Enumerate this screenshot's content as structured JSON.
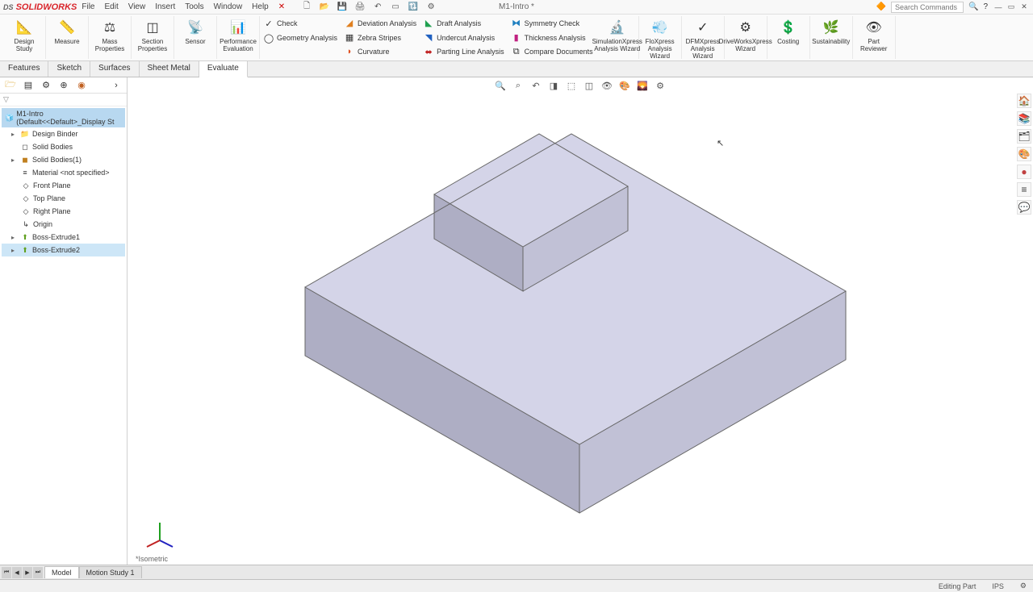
{
  "app": {
    "logo_ds": "DS",
    "logo_name": "SOLIDWORKS",
    "doc_title": "M1-Intro *"
  },
  "menu": {
    "file": "File",
    "edit": "Edit",
    "view": "View",
    "insert": "Insert",
    "tools": "Tools",
    "window": "Window",
    "help": "Help"
  },
  "search": {
    "placeholder": "Search Commands"
  },
  "ribbon": {
    "design_study": "Design\nStudy",
    "measure": "Measure",
    "mass_props": "Mass\nProperties",
    "section_props": "Section\nProperties",
    "sensor": "Sensor",
    "perf_eval": "Performance\nEvaluation",
    "check": "Check",
    "geom_analysis": "Geometry Analysis",
    "dev_analysis": "Deviation Analysis",
    "zebra": "Zebra Stripes",
    "curvature": "Curvature",
    "draft_analysis": "Draft Analysis",
    "undercut": "Undercut Analysis",
    "parting_line": "Parting Line Analysis",
    "symmetry": "Symmetry Check",
    "thickness": "Thickness Analysis",
    "compare": "Compare Documents",
    "sim_xpress": "SimulationXpress\nAnalysis Wizard",
    "flo_xpress": "FloXpress\nAnalysis\nWizard",
    "dfm_xpress": "DFMXpress\nAnalysis\nWizard",
    "drive_works": "DriveWorksXpress\nWizard",
    "costing": "Costing",
    "sustainability": "Sustainability",
    "part_reviewer": "Part\nReviewer"
  },
  "tabs": {
    "features": "Features",
    "sketch": "Sketch",
    "surfaces": "Surfaces",
    "sheet_metal": "Sheet Metal",
    "evaluate": "Evaluate"
  },
  "tree": {
    "root": "M1-Intro (Default<<Default>_Display St",
    "design_binder": "Design Binder",
    "solid_bodies": "Solid Bodies",
    "solid_bodies1": "Solid Bodies(1)",
    "material": "Material <not specified>",
    "front_plane": "Front Plane",
    "top_plane": "Top Plane",
    "right_plane": "Right Plane",
    "origin": "Origin",
    "boss_extrude1": "Boss-Extrude1",
    "boss_extrude2": "Boss-Extrude2"
  },
  "view": {
    "label": "*Isometric"
  },
  "bottom_tabs": {
    "model": "Model",
    "motion1": "Motion Study 1"
  },
  "status": {
    "editing": "Editing Part",
    "units": "IPS"
  }
}
